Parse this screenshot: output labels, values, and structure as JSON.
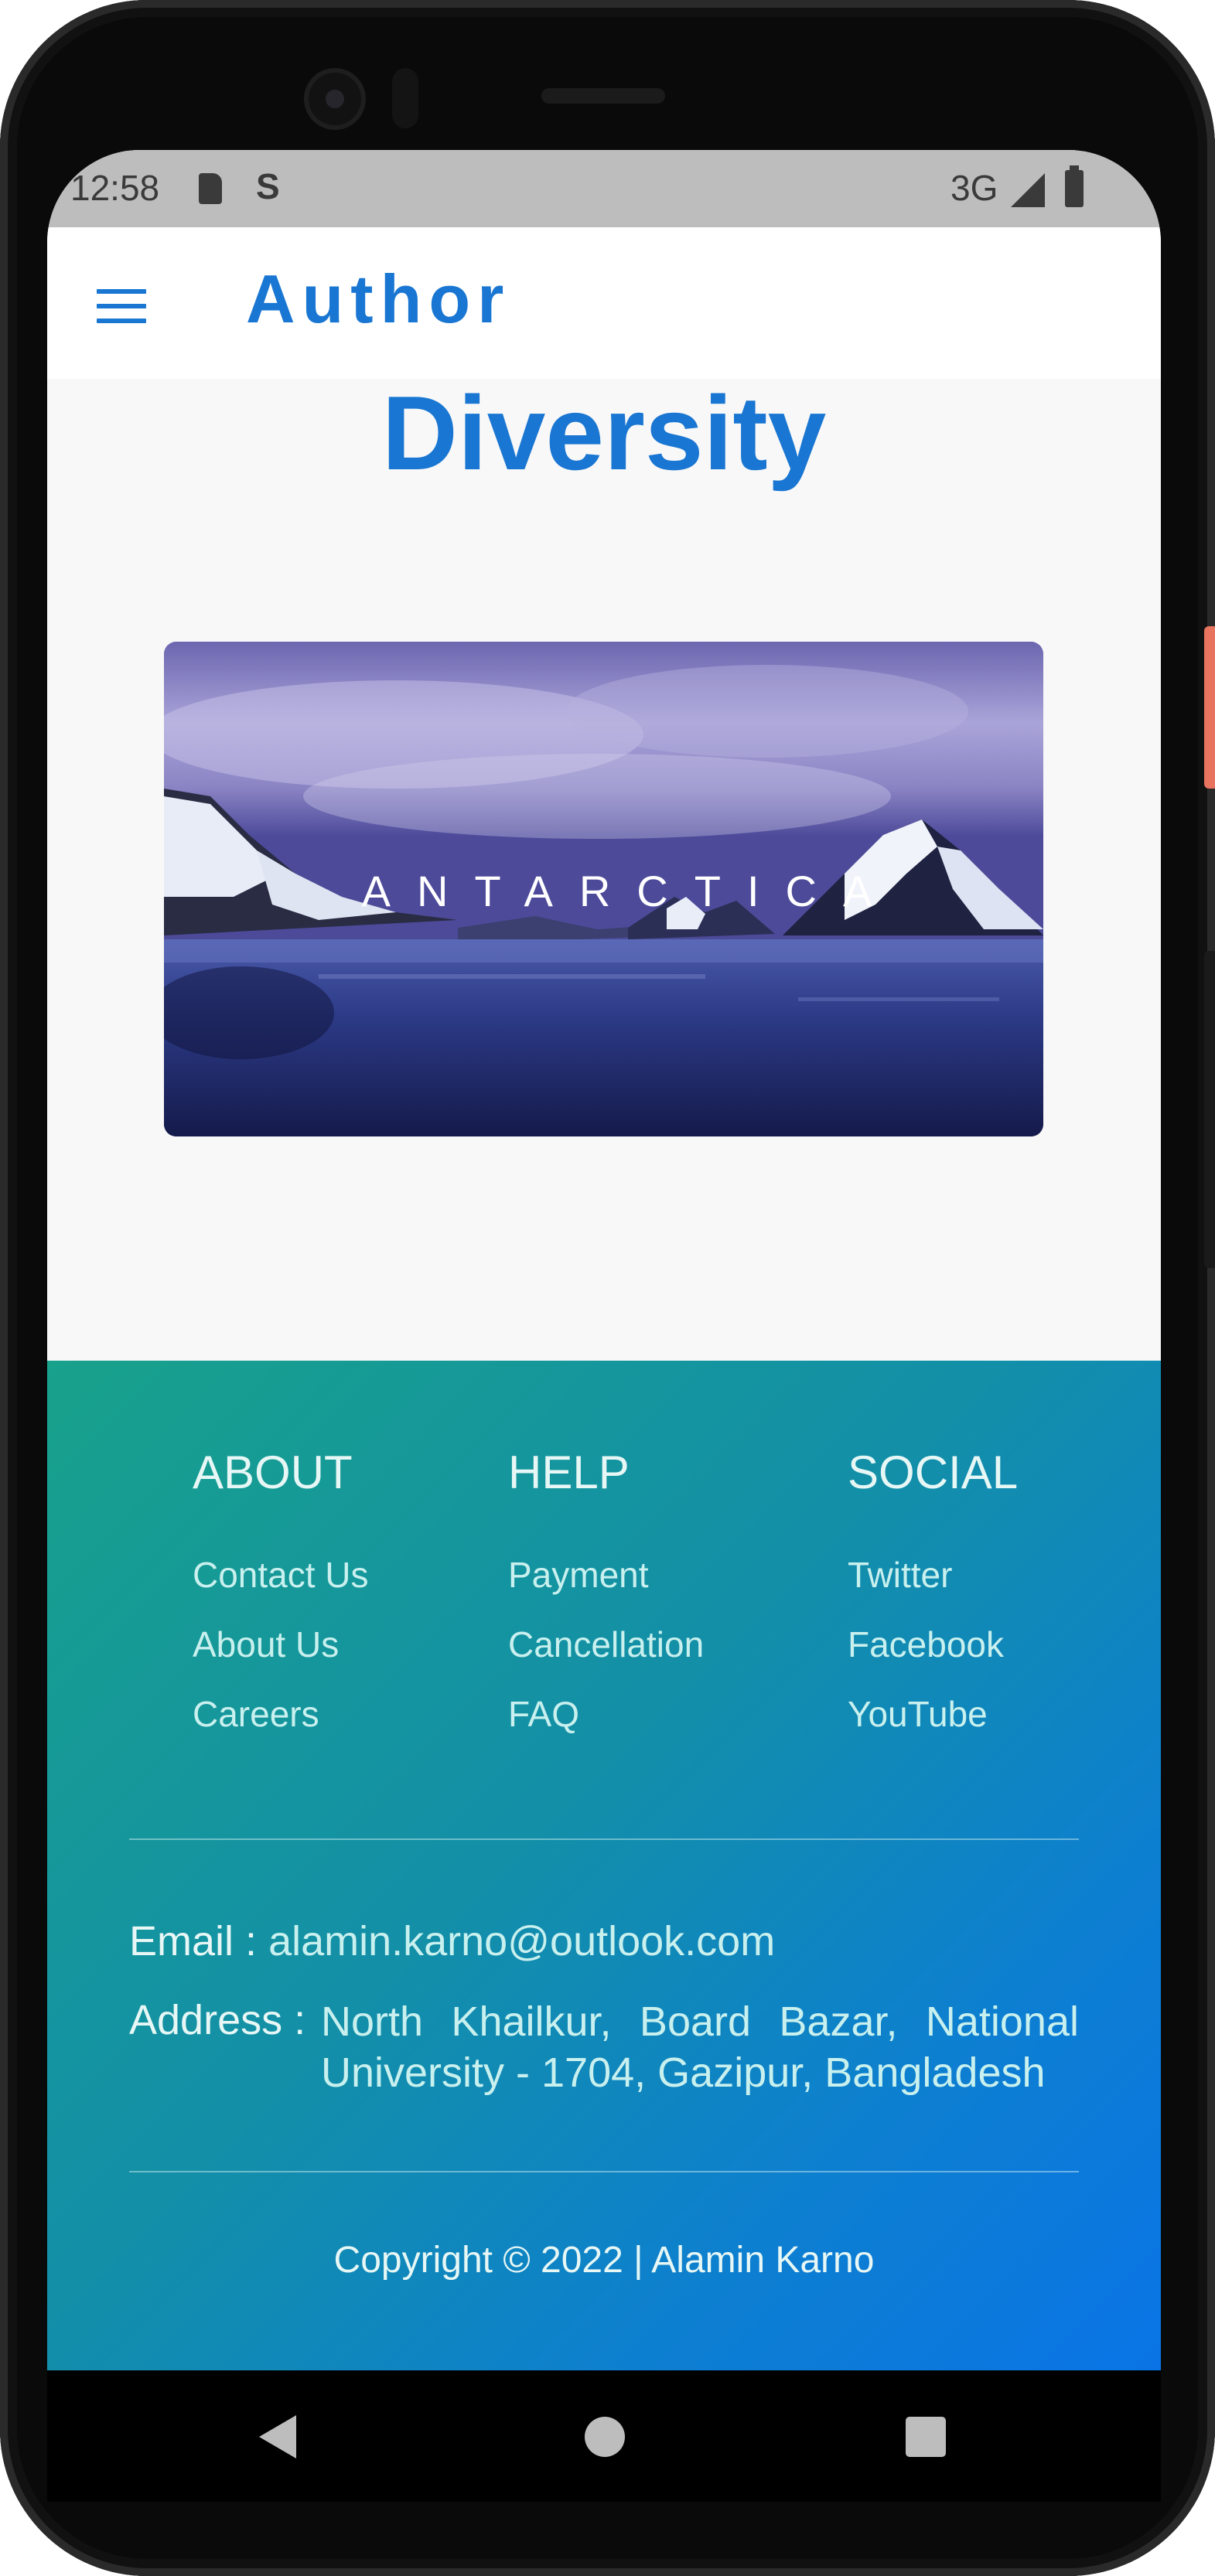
{
  "status_bar": {
    "time": "12:58",
    "s_icon": "S",
    "network": "3G",
    "icons": [
      "sd-card-icon",
      "s-icon",
      "signal-icon",
      "battery-icon"
    ]
  },
  "app_bar": {
    "title": "Author",
    "menu_icon": "hamburger-menu-icon",
    "accent": "#1976d2"
  },
  "main": {
    "page_title": "Diversity",
    "hero": {
      "caption": "ANTARCTICA"
    }
  },
  "footer": {
    "columns": [
      {
        "heading": "ABOUT",
        "links": [
          "Contact Us",
          "About Us",
          "Careers"
        ]
      },
      {
        "heading": "HELP",
        "links": [
          "Payment",
          "Cancellation",
          "FAQ"
        ]
      },
      {
        "heading": "SOCIAL",
        "links": [
          "Twitter",
          "Facebook",
          "YouTube"
        ]
      }
    ],
    "email_label": "Email :",
    "email_value": "alamin.karno@outlook.com",
    "address_label": "Address :",
    "address_value": "North Khailkur, Board Bazar, National University - 1704, Gazipur, Bangladesh",
    "copyright": "Copyright © 2022 | Alamin Karno",
    "gradient_start": "#18a18b",
    "gradient_end": "#0a74e6"
  },
  "nav_bar": {
    "icons": [
      "back-icon",
      "home-icon",
      "recents-icon"
    ]
  }
}
